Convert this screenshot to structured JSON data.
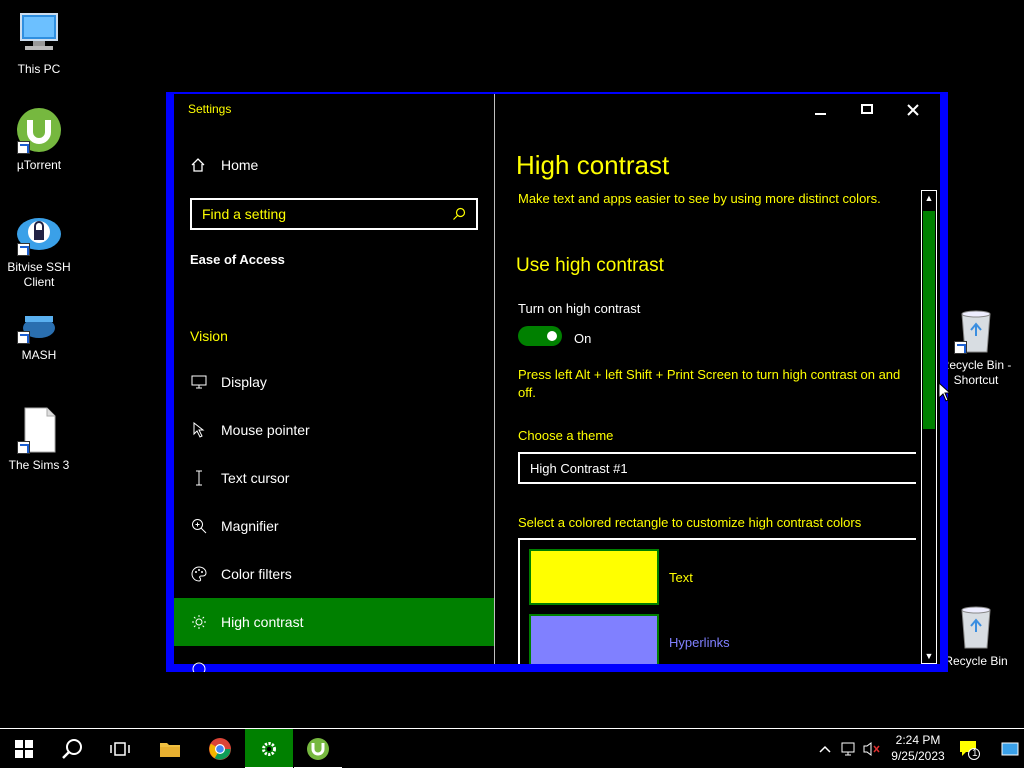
{
  "desktop": {
    "icons": [
      {
        "label": "This PC"
      },
      {
        "label": "µTorrent"
      },
      {
        "label": "Bitvise SSH Client"
      },
      {
        "label": "MASH"
      },
      {
        "label": "The Sims 3"
      },
      {
        "label": "Recycle Bin - Shortcut"
      },
      {
        "label": "Recycle Bin"
      }
    ]
  },
  "window": {
    "title": "Settings",
    "nav": {
      "home": "Home",
      "search_placeholder": "Find a setting",
      "section": "Ease of Access",
      "group": "Vision",
      "items": [
        {
          "label": "Display",
          "icon": "monitor-icon"
        },
        {
          "label": "Mouse pointer",
          "icon": "mouse-pointer-icon"
        },
        {
          "label": "Text cursor",
          "icon": "text-cursor-icon"
        },
        {
          "label": "Magnifier",
          "icon": "magnifier-icon"
        },
        {
          "label": "Color filters",
          "icon": "palette-icon"
        },
        {
          "label": "High contrast",
          "icon": "sun-icon",
          "active": true
        }
      ]
    },
    "content": {
      "title": "High contrast",
      "subtitle": "Make text and apps easier to see by using more distinct colors.",
      "section_title": "Use high contrast",
      "toggle_label": "Turn on high contrast",
      "toggle_state": "On",
      "shortcut_hint": "Press left Alt + left Shift + Print Screen to turn high contrast on and off.",
      "theme_label": "Choose a theme",
      "theme_value": "High Contrast #1",
      "rect_label": "Select a colored rectangle to customize high contrast colors",
      "swatches": [
        {
          "label": "Text",
          "color": "#ffff00"
        },
        {
          "label": "Hyperlinks",
          "color": "#8080ff"
        }
      ]
    }
  },
  "taskbar": {
    "time": "2:24 PM",
    "date": "9/25/2023",
    "notification_count": "1"
  },
  "colors": {
    "accent": "#008000",
    "text_yellow": "#ffff00",
    "window_border": "#0000ff",
    "hyperlink": "#8080ff"
  }
}
